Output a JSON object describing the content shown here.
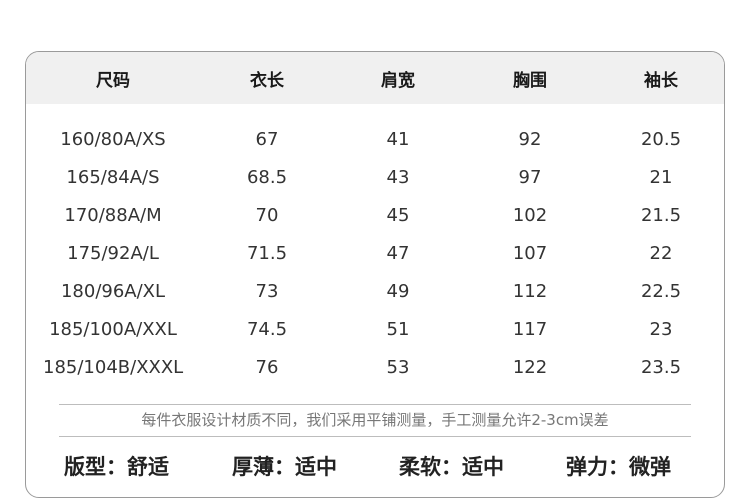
{
  "size_table": {
    "headers": [
      "尺码",
      "衣长",
      "肩宽",
      "胸围",
      "袖长"
    ],
    "rows": [
      [
        "160/80A/XS",
        "67",
        "41",
        "92",
        "20.5"
      ],
      [
        "165/84A/S",
        "68.5",
        "43",
        "97",
        "21"
      ],
      [
        "170/88A/M",
        "70",
        "45",
        "102",
        "21.5"
      ],
      [
        "175/92A/L",
        "71.5",
        "47",
        "107",
        "22"
      ],
      [
        "180/96A/XL",
        "73",
        "49",
        "112",
        "22.5"
      ],
      [
        "185/100A/XXL",
        "74.5",
        "51",
        "117",
        "23"
      ],
      [
        "185/104B/XXXL",
        "76",
        "53",
        "122",
        "23.5"
      ]
    ]
  },
  "note": "每件衣服设计材质不同，我们采用平铺测量，手工测量允许2-3cm误差",
  "attributes": [
    "版型：舒适",
    "厚薄：适中",
    "柔软：适中",
    "弹力：微弹"
  ]
}
